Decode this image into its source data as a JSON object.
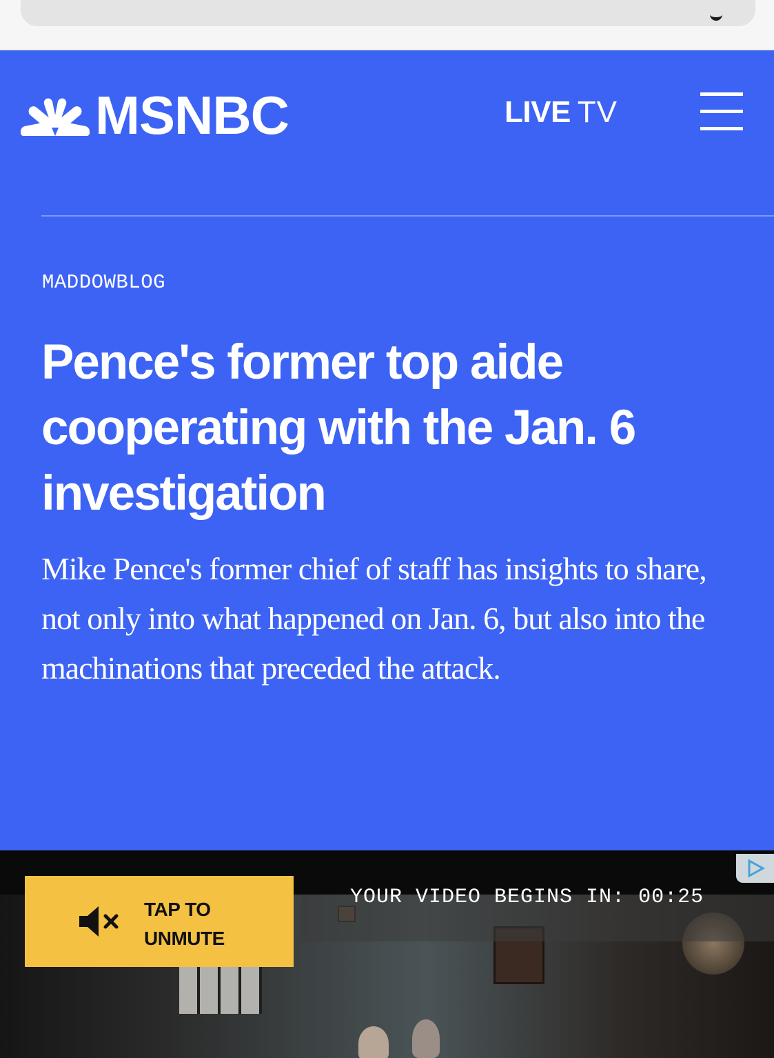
{
  "header": {
    "brand": "MSNBC",
    "live_label": "LIVE",
    "tv_label": "TV",
    "menu_icon": "hamburger-menu-icon",
    "brand_color": "#3d63f5"
  },
  "article": {
    "section": "MADDOWBLOG",
    "headline": "Pence's former top aide cooperating with the Jan. 6 investigation",
    "dek": "Mike Pence's former chief of staff has insights to share, not only into what happened on Jan. 6, but also into the machinations that preceded the attack."
  },
  "video": {
    "unmute_label": "TAP TO UNMUTE",
    "countdown": "YOUR VIDEO BEGINS IN: 00:25",
    "unmute_button_color": "#f4c143",
    "mute_icon": "speaker-muted-icon",
    "ad_icon": "adchoices-icon"
  }
}
